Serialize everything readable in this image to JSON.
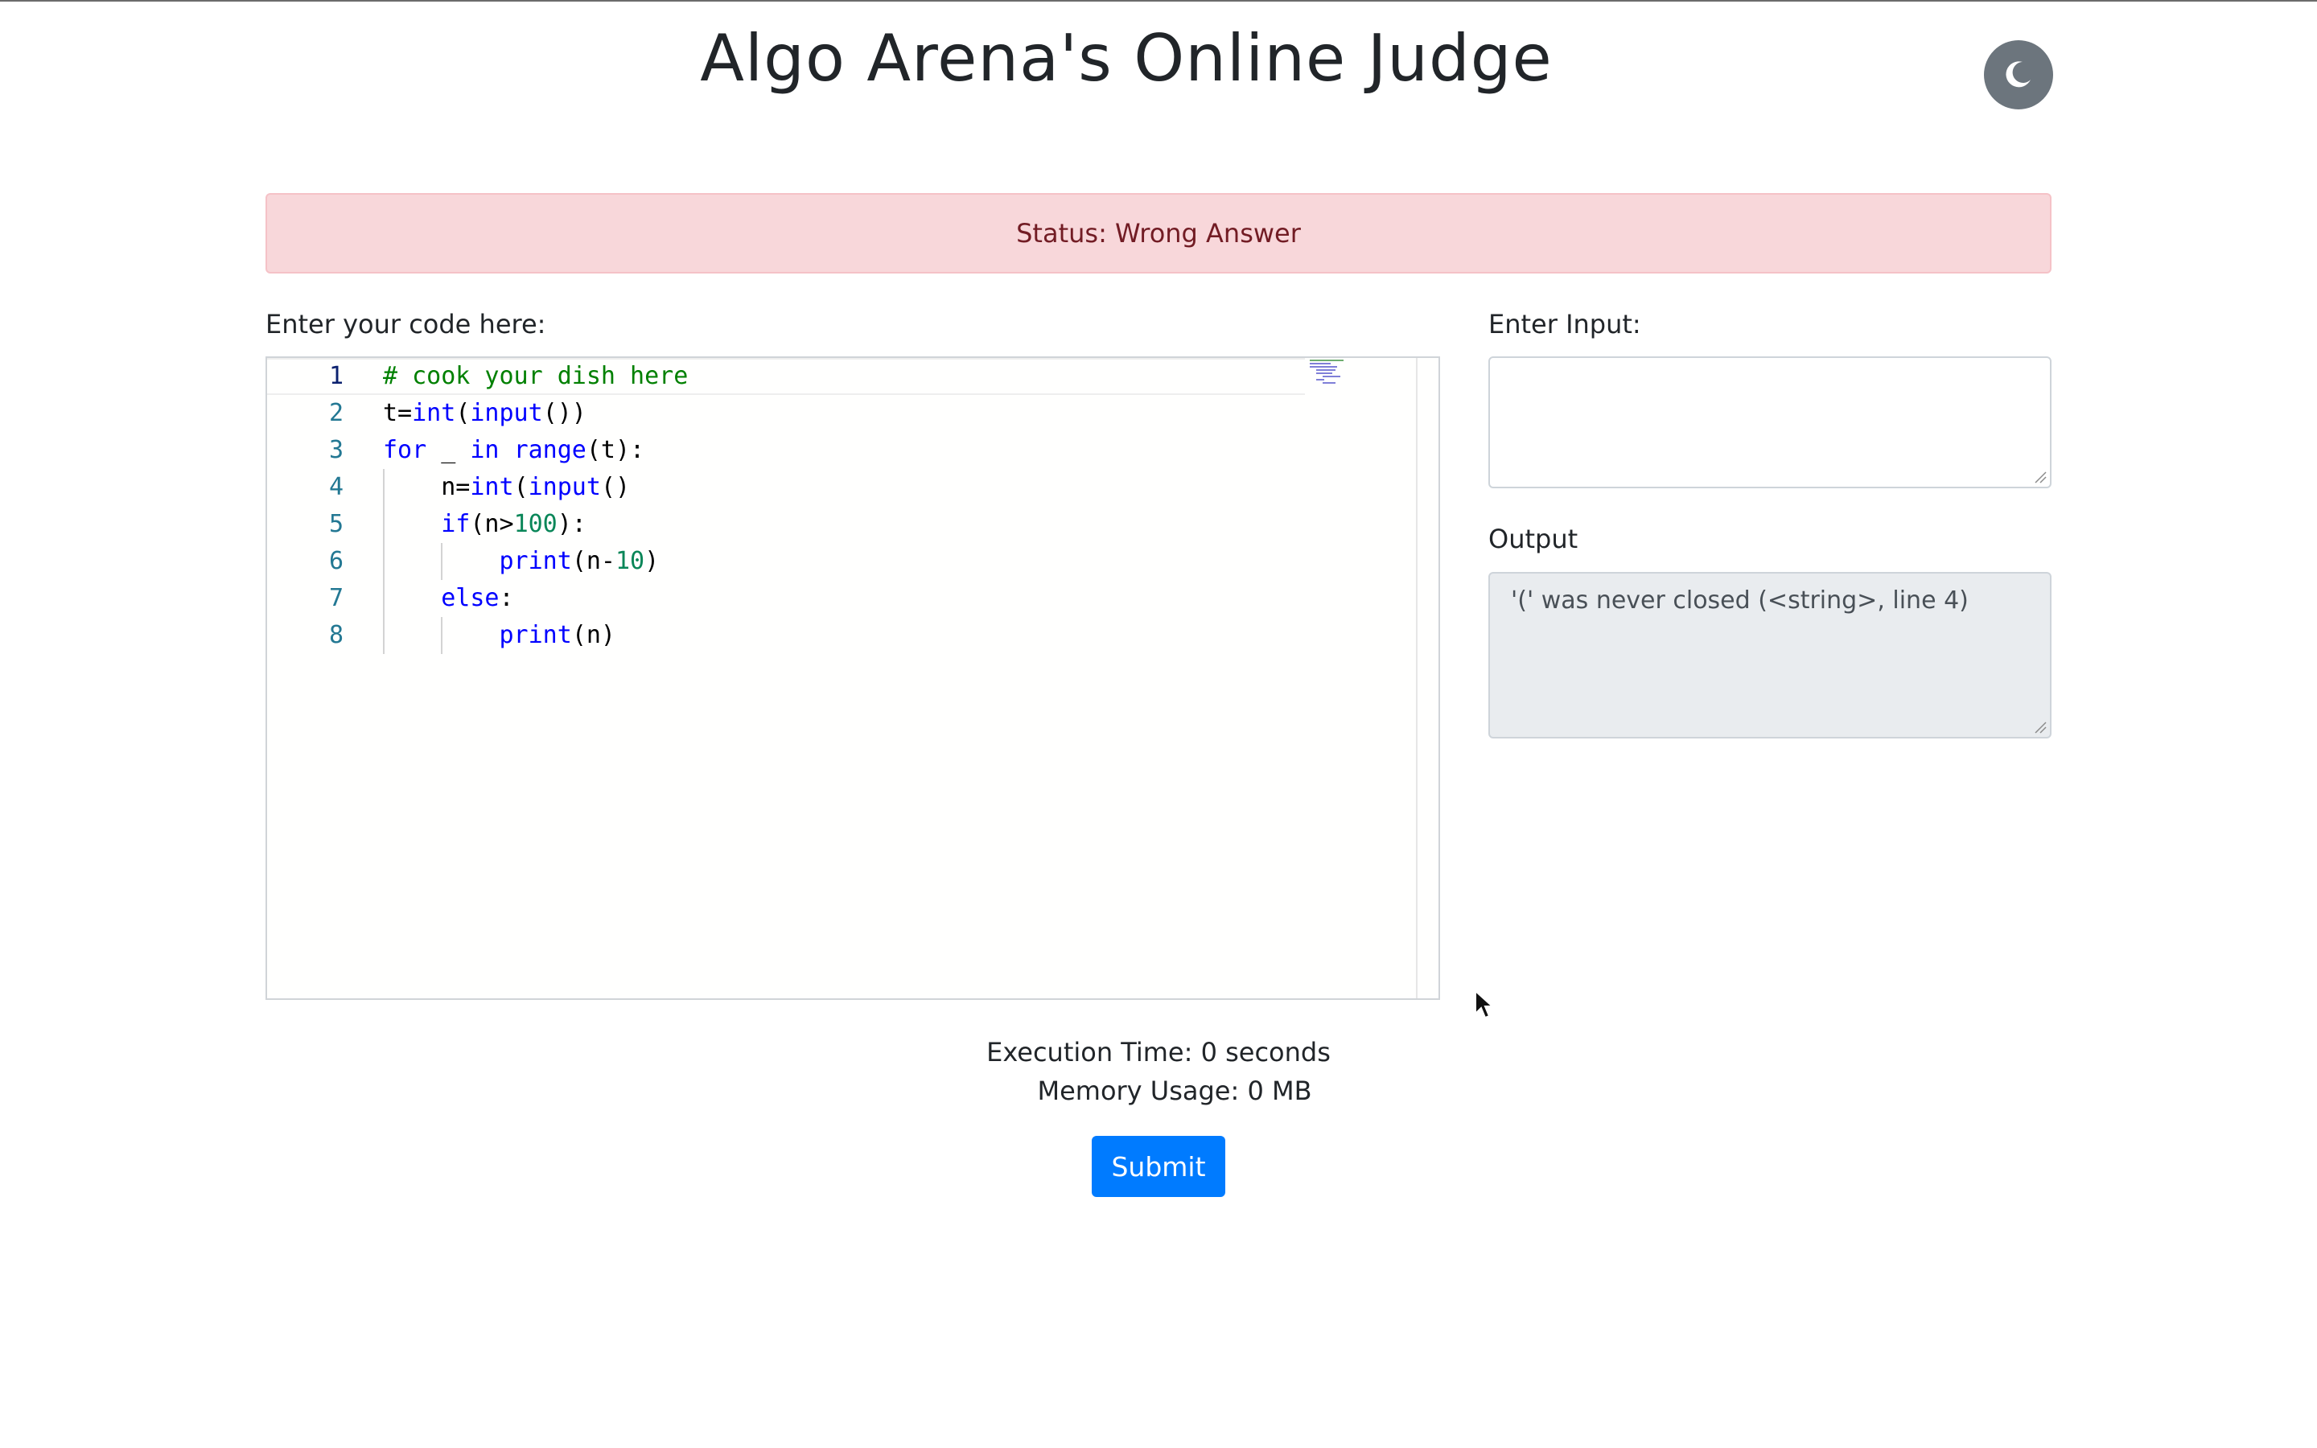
{
  "header": {
    "title": "Algo Arena's Online Judge",
    "theme_toggle_icon": "moon-icon"
  },
  "status": {
    "text": "Status: Wrong Answer",
    "background": "#f8d7da",
    "color": "#721c24"
  },
  "editor": {
    "label": "Enter your code here:",
    "line_numbers": [
      "1",
      "2",
      "3",
      "4",
      "5",
      "6",
      "7",
      "8"
    ],
    "lines": [
      "# cook your dish here",
      "t=int(input())",
      "for _ in range(t):",
      "    n=int(input()",
      "    if(n>100):",
      "        print(n-10)",
      "    else:",
      "        print(n)"
    ]
  },
  "input": {
    "label": "Enter Input:",
    "value": ""
  },
  "output": {
    "label": "Output",
    "value": "'(' was never closed (<string>, line 4)"
  },
  "stats": {
    "execution_time": "Execution Time: 0 seconds",
    "memory_usage": "Memory Usage: 0 MB"
  },
  "submit": {
    "label": "Submit",
    "color": "#007bff"
  }
}
